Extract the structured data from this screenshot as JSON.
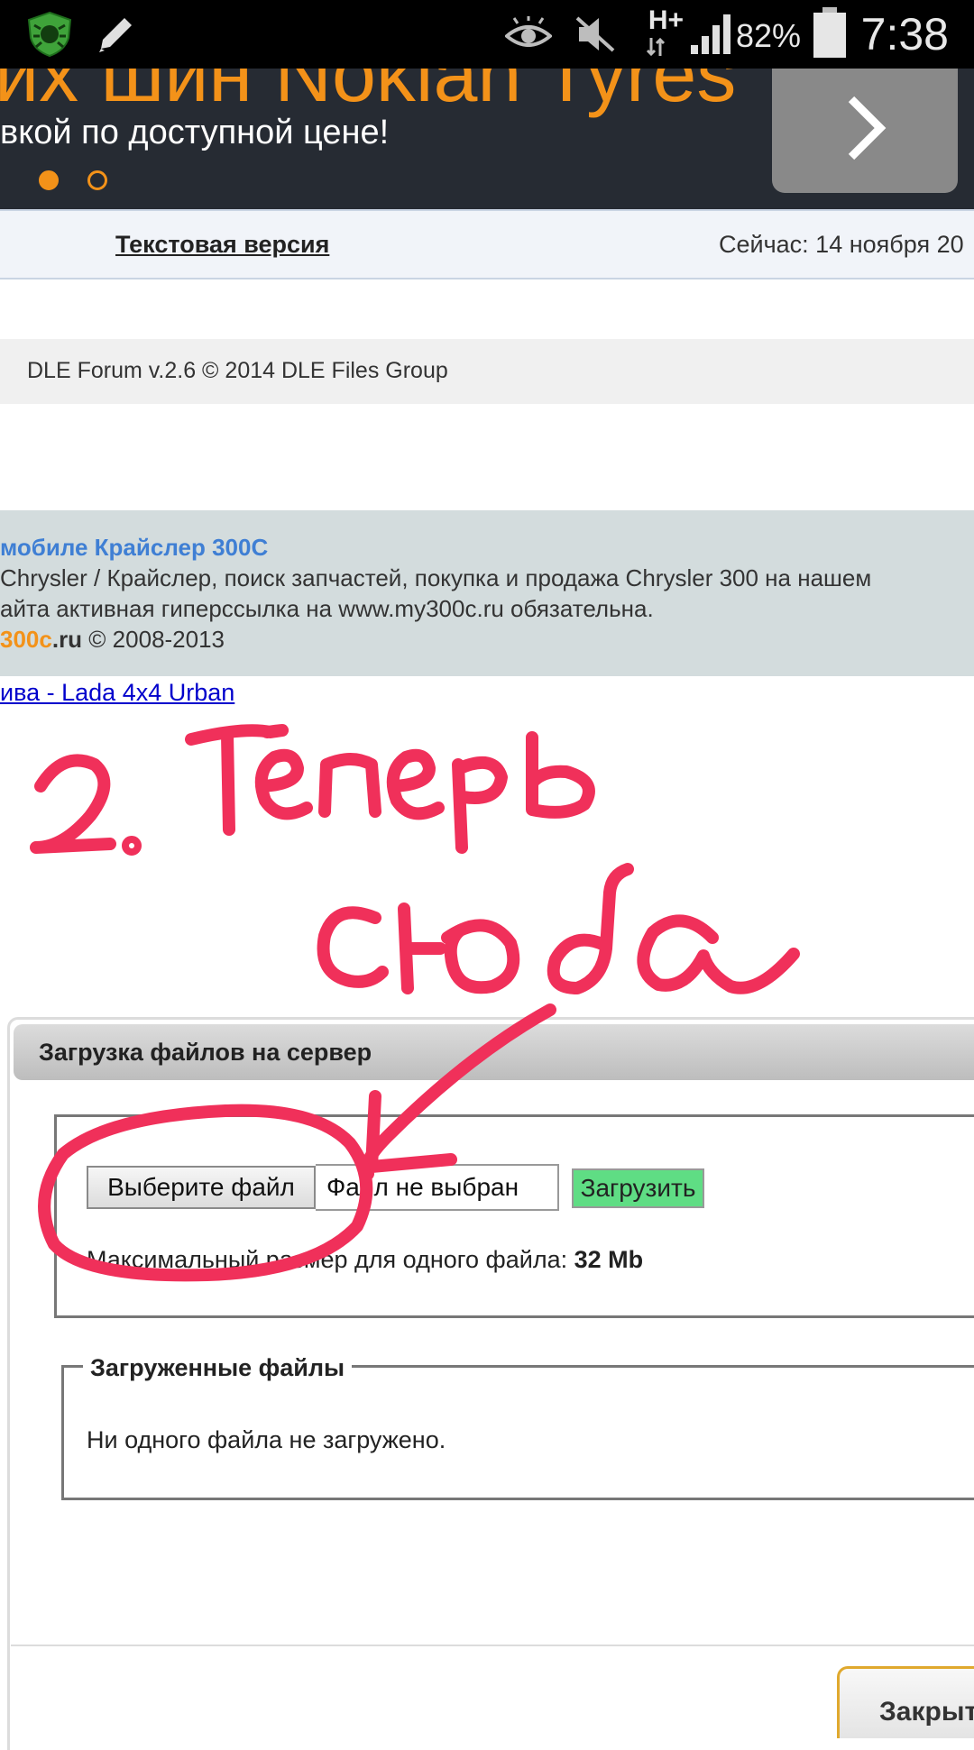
{
  "status_bar": {
    "network": "H+",
    "battery_percent": "82%",
    "time": "7:38",
    "icons": [
      "shield-bug-icon",
      "pencil-icon",
      "eye-icon",
      "mute-icon",
      "signal-icon",
      "battery-icon"
    ]
  },
  "banner": {
    "headline": "их шин Nokian Tyres",
    "subline": "вкой по доступной цене!",
    "slides_total": 2,
    "active_slide": 1,
    "accent_color": "#f39219"
  },
  "nav": {
    "text_version": "Текстовая версия",
    "now": "Сейчас: 14 ноября 20"
  },
  "forum_copyright": "DLE Forum v.2.6 © 2014 DLE Files Group",
  "site_footer": {
    "title": "мобиле Крайслер 300С",
    "line1": "Chrysler / Крайслер, поиск запчастей, покупка и продажа Chrysler 300 на нашем",
    "line2": "айта активная гиперссылка на www.my300c.ru обязательна.",
    "brand_orange": "300c",
    "brand_rest": ".ru",
    "years": " © 2008-2013"
  },
  "niva_link": "ива - Lada 4x4 Urban",
  "annotation": {
    "line1": "2. Теперь",
    "line2": "сюда",
    "color": "#f0305a"
  },
  "upload_dialog": {
    "title": "Загрузка файлов на сервер",
    "choose_file": "Выберите файл",
    "file_status": "Файл не выбран",
    "upload": "Загрузить",
    "max_size_label": "Максимальный размер для одного файла: ",
    "max_size_value": "32 Mb",
    "uploaded_legend": "Загруженные файлы",
    "no_files": "Ни одного файла не загружено.",
    "close": "Закрыт"
  }
}
